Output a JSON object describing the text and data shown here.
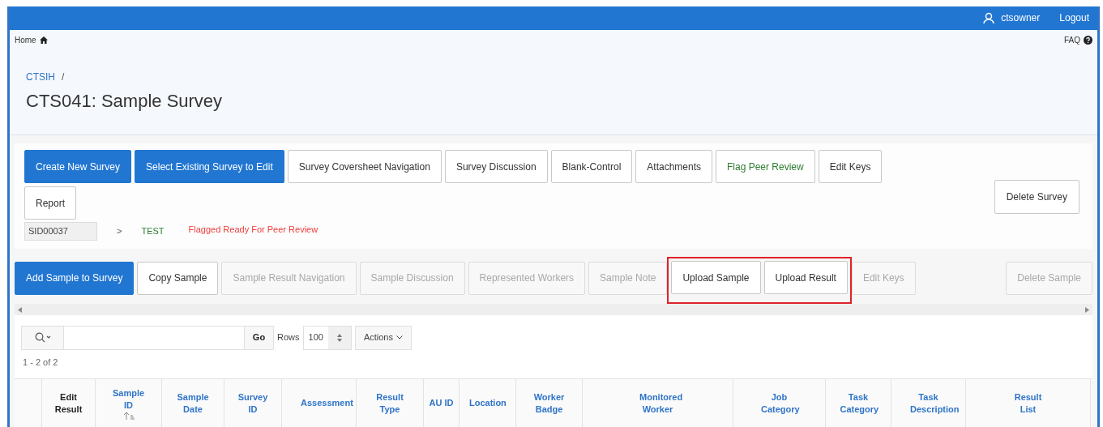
{
  "top_bar": {
    "user": "ctsowner",
    "logout": "Logout"
  },
  "breadcrumb_bar": {
    "home": "Home",
    "faq": "FAQ"
  },
  "header": {
    "parent": "CTSIH",
    "separator": "/",
    "title": "CTS041: Sample Survey"
  },
  "survey_buttons": [
    {
      "label": "Create New Survey",
      "kind": "primary"
    },
    {
      "label": "Select Existing Survey to Edit",
      "kind": "primary"
    },
    {
      "label": "Survey Coversheet Navigation",
      "kind": "default"
    },
    {
      "label": "Survey Discussion",
      "kind": "default"
    },
    {
      "label": "Blank-Control",
      "kind": "default"
    },
    {
      "label": "Attachments",
      "kind": "default"
    },
    {
      "label": "Flag Peer Review",
      "kind": "success"
    },
    {
      "label": "Edit Keys",
      "kind": "default"
    },
    {
      "label": "Report",
      "kind": "default"
    }
  ],
  "delete_survey": "Delete Survey",
  "survey_status": {
    "survey_id": "SID00037",
    "arrow": ">",
    "name": "TEST",
    "flag": "Flagged Ready For Peer Review"
  },
  "sample_toolbar": [
    {
      "kind": "button",
      "label": "Add Sample to Survey",
      "primary": true,
      "disabled": false
    },
    {
      "kind": "button",
      "label": "Copy Sample",
      "primary": false,
      "disabled": false
    },
    {
      "kind": "button",
      "label": "Sample Result Navigation",
      "primary": false,
      "disabled": true
    },
    {
      "kind": "button",
      "label": "Sample Discussion",
      "primary": false,
      "disabled": true
    },
    {
      "kind": "button",
      "label": "Represented Workers",
      "primary": false,
      "disabled": true
    },
    {
      "kind": "button",
      "label": "Sample Note",
      "primary": false,
      "disabled": true
    },
    {
      "kind": "highlight_group",
      "buttons": [
        {
          "label": "Upload Sample",
          "primary": false,
          "disabled": false
        },
        {
          "label": "Upload Result",
          "primary": false,
          "disabled": false
        }
      ]
    },
    {
      "kind": "button",
      "label": "Edit Keys",
      "primary": false,
      "disabled": true
    }
  ],
  "delete_sample": {
    "label": "Delete Sample",
    "disabled": true
  },
  "report_toolbar": {
    "go": "Go",
    "rows_label": "Rows",
    "rows_value": "100",
    "actions": "Actions",
    "pagination": "1 - 2 of 2"
  },
  "table": {
    "columns": [
      {
        "label": "Edit Result",
        "link": false,
        "sorted": false
      },
      {
        "label": "Sample ID",
        "link": true,
        "sorted": true
      },
      {
        "label": "Sample Date",
        "link": true,
        "sorted": false
      },
      {
        "label": "Survey ID",
        "link": true,
        "sorted": false
      },
      {
        "label": "Assessment",
        "link": true,
        "sorted": false
      },
      {
        "label": "Result Type",
        "link": true,
        "sorted": false
      },
      {
        "label": "AU ID",
        "link": true,
        "sorted": false
      },
      {
        "label": "Location",
        "link": true,
        "sorted": false
      },
      {
        "label": "Worker Badge",
        "link": true,
        "sorted": false
      },
      {
        "label": "Monitored Worker",
        "link": true,
        "sorted": false
      },
      {
        "label": "Job Category",
        "link": true,
        "sorted": false
      },
      {
        "label": "Task Category",
        "link": true,
        "sorted": false
      },
      {
        "label": "Task Description",
        "link": true,
        "sorted": false
      },
      {
        "label": "Result List",
        "link": true,
        "sorted": false
      }
    ]
  }
}
